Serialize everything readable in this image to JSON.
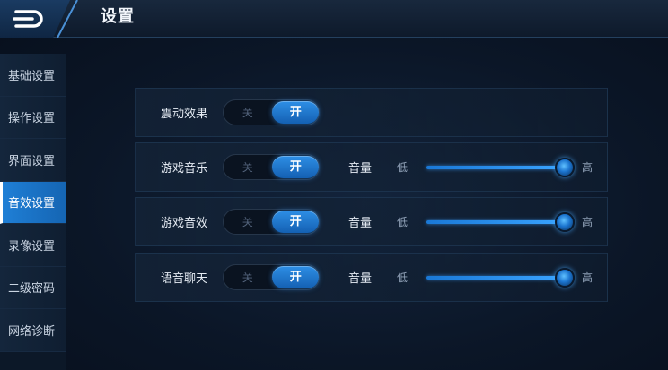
{
  "header": {
    "title": "设置"
  },
  "sidebar": {
    "items": [
      {
        "label": "基础设置",
        "active": false
      },
      {
        "label": "操作设置",
        "active": false
      },
      {
        "label": "界面设置",
        "active": false
      },
      {
        "label": "音效设置",
        "active": true
      },
      {
        "label": "录像设置",
        "active": false
      },
      {
        "label": "二级密码",
        "active": false
      },
      {
        "label": "网络诊断",
        "active": false
      }
    ]
  },
  "settings": {
    "vibration": {
      "label": "震动效果",
      "off_label": "关",
      "on_label": "开",
      "state": "on"
    },
    "music": {
      "label": "游戏音乐",
      "off_label": "关",
      "on_label": "开",
      "state": "on",
      "volume_label": "音量",
      "low_label": "低",
      "high_label": "高",
      "volume": 1.0
    },
    "sfx": {
      "label": "游戏音效",
      "off_label": "关",
      "on_label": "开",
      "state": "on",
      "volume_label": "音量",
      "low_label": "低",
      "high_label": "高",
      "volume": 1.0
    },
    "voice": {
      "label": "语音聊天",
      "off_label": "关",
      "on_label": "开",
      "state": "on",
      "volume_label": "音量",
      "low_label": "低",
      "high_label": "高",
      "volume": 1.0
    }
  },
  "colors": {
    "accent": "#1f7fd6",
    "background": "#0b1627"
  },
  "icons": {
    "back": "back-arrow-icon"
  }
}
